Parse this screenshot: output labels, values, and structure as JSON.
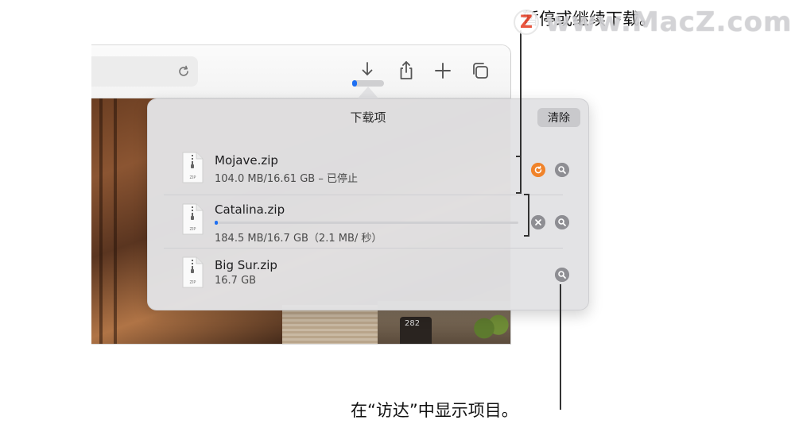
{
  "popover": {
    "title": "下载项",
    "clear_label": "清除",
    "items": [
      {
        "name": "Mojave.zip",
        "status": "104.0 MB/16.61 GB – 已停止",
        "action": "resume"
      },
      {
        "name": "Catalina.zip",
        "status": "184.5 MB/16.7 GB（2.1 MB/ 秒）",
        "progress_fraction": 0.011,
        "action": "cancel"
      },
      {
        "name": "Big Sur.zip",
        "status": "16.7 GB"
      }
    ],
    "file_icon_label": "ZIP"
  },
  "toolbar": {
    "download_progress_fraction": 0.011
  },
  "callouts": {
    "top": "暂停或继续下载。",
    "bottom": "在“访达”中显示项目。"
  },
  "content": {
    "lamp_number": "282"
  },
  "watermark": {
    "text": "www.MacZ.com",
    "badge": "Z"
  },
  "colors": {
    "accent_blue": "#1e6ff2",
    "resume_orange": "#f0832a",
    "button_gray": "#8e8e93"
  }
}
